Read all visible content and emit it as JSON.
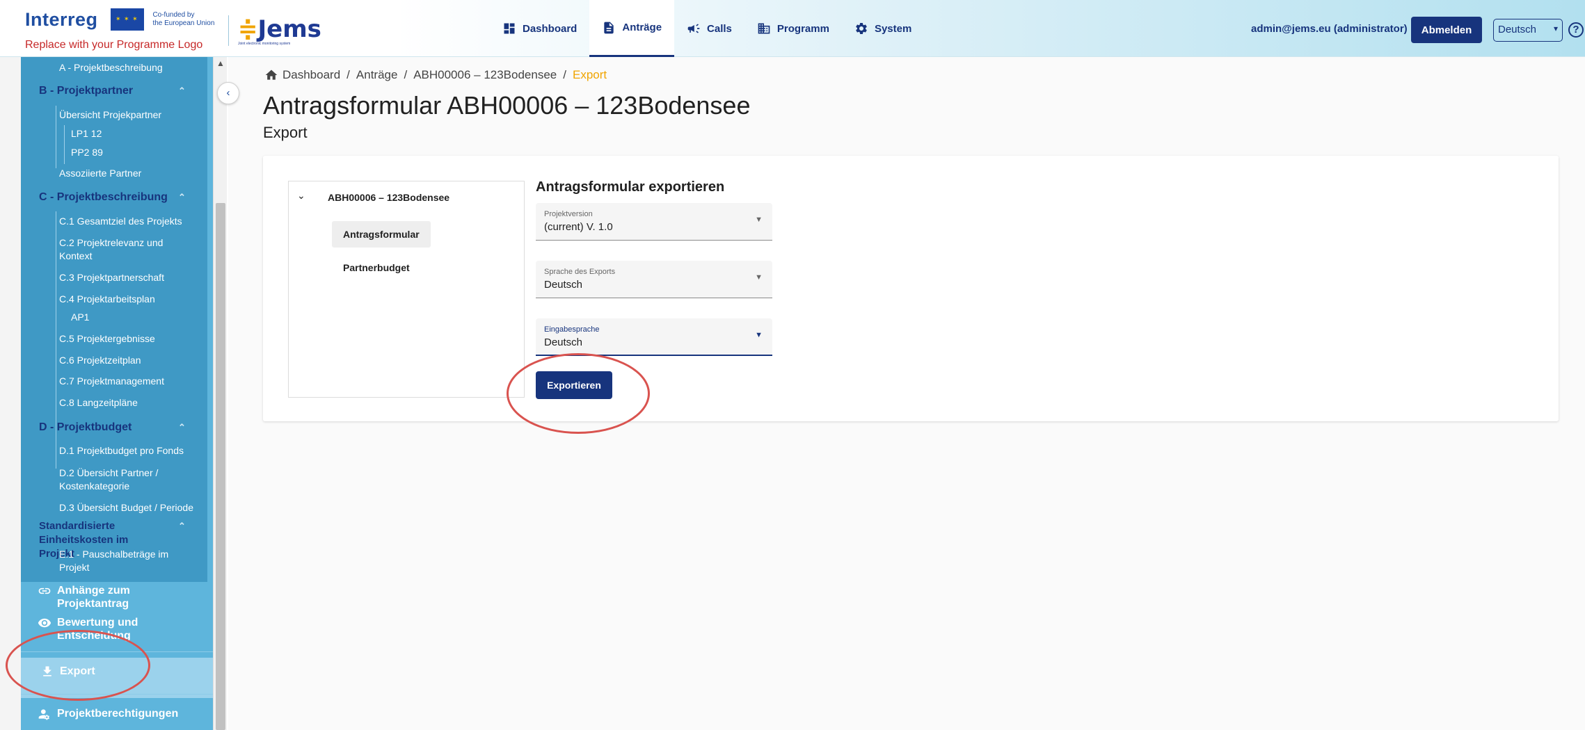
{
  "header": {
    "interreg": "Interreg",
    "eu_cofunded_line1": "Co-funded by",
    "eu_cofunded_line2": "the European Union",
    "programme_logo": "Replace with your Programme Logo",
    "jems_name": "Jems",
    "jems_subtitle": "Joint electronic monitoring system",
    "nav": [
      {
        "label": "Dashboard",
        "icon": "dashboard-icon"
      },
      {
        "label": "Anträge",
        "icon": "document-icon",
        "active": true
      },
      {
        "label": "Calls",
        "icon": "megaphone-icon"
      },
      {
        "label": "Programm",
        "icon": "building-icon"
      },
      {
        "label": "System",
        "icon": "gear-icon"
      }
    ],
    "user": "admin@jems.eu (administrator)",
    "logout": "Abmelden",
    "language": "Deutsch"
  },
  "sidebar": {
    "a_item": "A - Projektbeschreibung",
    "b_head": "B - Projektpartner",
    "b_items": [
      "Übersicht Projekpartner",
      "LP1 12",
      "PP2 89",
      "Assoziierte Partner"
    ],
    "c_head": "C - Projektbeschreibung",
    "c_items": [
      "C.1 Gesamtziel des Projekts",
      "C.2 Projektrelevanz und Kontext",
      "C.3 Projektpartnerschaft",
      "C.4 Projektarbeitsplan",
      "AP1",
      "C.5 Projektergebnisse",
      "C.6 Projektzeitplan",
      "C.7 Projektmanagement",
      "C.8 Langzeitpläne"
    ],
    "d_head": "D - Projektbudget",
    "d_items": [
      "D.1 Projektbudget pro Fonds",
      "D.2 Übersicht Partner / Kostenkategorie",
      "D.3 Übersicht Budget / Periode"
    ],
    "e_head": "Standardisierte Einheitskosten im Projekt",
    "e_items": [
      "E.1 - Pauschalbeträge im Projekt"
    ],
    "main_items": {
      "attachments": "Anhänge zum Projektantrag",
      "assessment": "Bewertung und Entscheidung",
      "export": "Export",
      "privileges": "Projektberechtigungen"
    }
  },
  "breadcrumb": {
    "home": "Dashboard",
    "antraege": "Anträge",
    "project": "ABH00006 – 123Bodensee",
    "current": "Export"
  },
  "page": {
    "title": "Antragsformular ABH00006 – 123Bodensee",
    "subtitle": "Export"
  },
  "tree": {
    "root": "ABH00006 – 123Bodensee",
    "items": [
      "Antragsformular",
      "Partnerbudget"
    ]
  },
  "form": {
    "title": "Antragsformular exportieren",
    "fields": [
      {
        "label": "Projektversion",
        "value": "(current) V. 1.0"
      },
      {
        "label": "Sprache des Exports",
        "value": "Deutsch"
      },
      {
        "label": "Eingabesprache",
        "value": "Deutsch"
      }
    ],
    "export_button": "Exportieren"
  },
  "colors": {
    "primary": "#17347d",
    "sidebar_dark": "#3f99c5",
    "sidebar_light": "#5eb5dc",
    "accent": "#f0a400",
    "annotation": "#d9534f"
  }
}
